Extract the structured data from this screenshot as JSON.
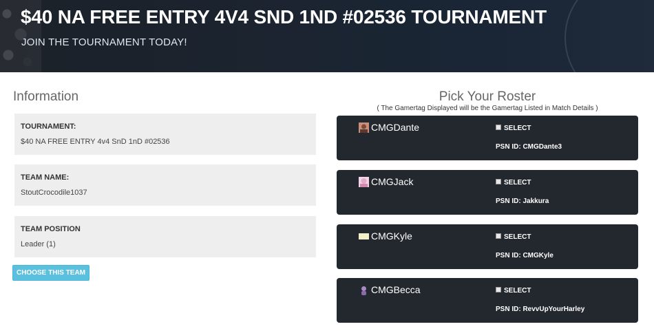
{
  "hero": {
    "title": "$40 NA FREE ENTRY 4V4 SND 1ND #02536 TOURNAMENT",
    "subtitle": "JOIN THE TOURNAMENT TODAY!"
  },
  "information": {
    "heading": "Information",
    "fields": [
      {
        "label": "TOURNAMENT:",
        "value": "$40 NA FREE ENTRY 4v4 SnD 1nD #02536"
      },
      {
        "label": "TEAM NAME:",
        "value": "StoutCrocodile1037"
      },
      {
        "label": "TEAM POSITION",
        "value": "Leader (1)"
      }
    ],
    "choose_button": "CHOOSE THIS TEAM"
  },
  "roster": {
    "heading": "Pick Your Roster",
    "note": "( The Gamertag Displayed will be the Gamertag Listed in Match Details )",
    "select_label": "SELECT",
    "players": [
      {
        "gamertag": "CMGDante",
        "psn": "PSN ID: CMGDante3",
        "avatar_color": "#c98f7a"
      },
      {
        "gamertag": "CMGJack",
        "psn": "PSN ID: Jakkura",
        "avatar_color": "#e6a8c8"
      },
      {
        "gamertag": "CMGKyle",
        "psn": "PSN ID: CMGKyle",
        "avatar_color": "#f3efc8"
      },
      {
        "gamertag": "CMGBecca",
        "psn": "PSN ID: RevvUpYourHarley",
        "avatar_color": "#a78ac0"
      }
    ]
  }
}
